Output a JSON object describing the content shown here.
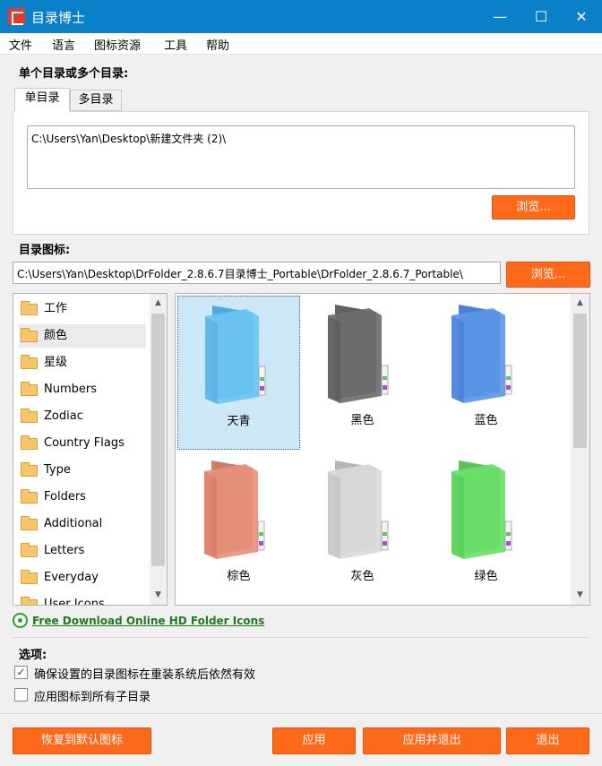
{
  "window": {
    "title": "目录博士",
    "minimize_glyph": "—",
    "maximize_glyph": "☐",
    "close_glyph": "✕"
  },
  "menu": [
    "文件",
    "语言",
    "图标资源",
    "工具",
    "帮助"
  ],
  "dirs": {
    "heading": "单个目录或多个目录:",
    "tabs": [
      "单目录",
      "多目录"
    ],
    "path": "C:\\Users\\Yan\\Desktop\\新建文件夹 (2)\\",
    "browse_label": "浏览..."
  },
  "icon_path": {
    "heading": "目录图标:",
    "value": "C:\\Users\\Yan\\Desktop\\DrFolder_2.8.6.7目录博士_Portable\\DrFolder_2.8.6.7_Portable\\",
    "browse_label": "浏览..."
  },
  "categories": [
    "工作",
    "颜色",
    "星级",
    "Numbers",
    "Zodiac",
    "Country Flags",
    "Type",
    "Folders",
    "Additional",
    "Letters",
    "Everyday",
    "User Icons"
  ],
  "selected_category": "颜色",
  "icons": [
    {
      "label": "天青",
      "color": "#6cc4f2",
      "dark": "#3d9ed6"
    },
    {
      "label": "黑色",
      "color": "#6e6e6e",
      "dark": "#454545"
    },
    {
      "label": "蓝色",
      "color": "#5b96e8",
      "dark": "#3068c9"
    },
    {
      "label": "棕色",
      "color": "#e8907a",
      "dark": "#c56650"
    },
    {
      "label": "灰色",
      "color": "#dadada",
      "dark": "#a8a8a8"
    },
    {
      "label": "绿色",
      "color": "#6de06a",
      "dark": "#3cb93a"
    }
  ],
  "selected_icon": "天青",
  "download_link": "Free Download Online HD Folder Icons",
  "options": {
    "heading": "选项:",
    "items": [
      {
        "label": "确保设置的目录图标在重装系统后依然有效",
        "checked": true
      },
      {
        "label": "应用图标到所有子目录",
        "checked": false
      }
    ]
  },
  "buttons": {
    "restore": "恢复到默认图标",
    "apply": "应用",
    "apply_exit": "应用并退出",
    "exit": "退出"
  }
}
